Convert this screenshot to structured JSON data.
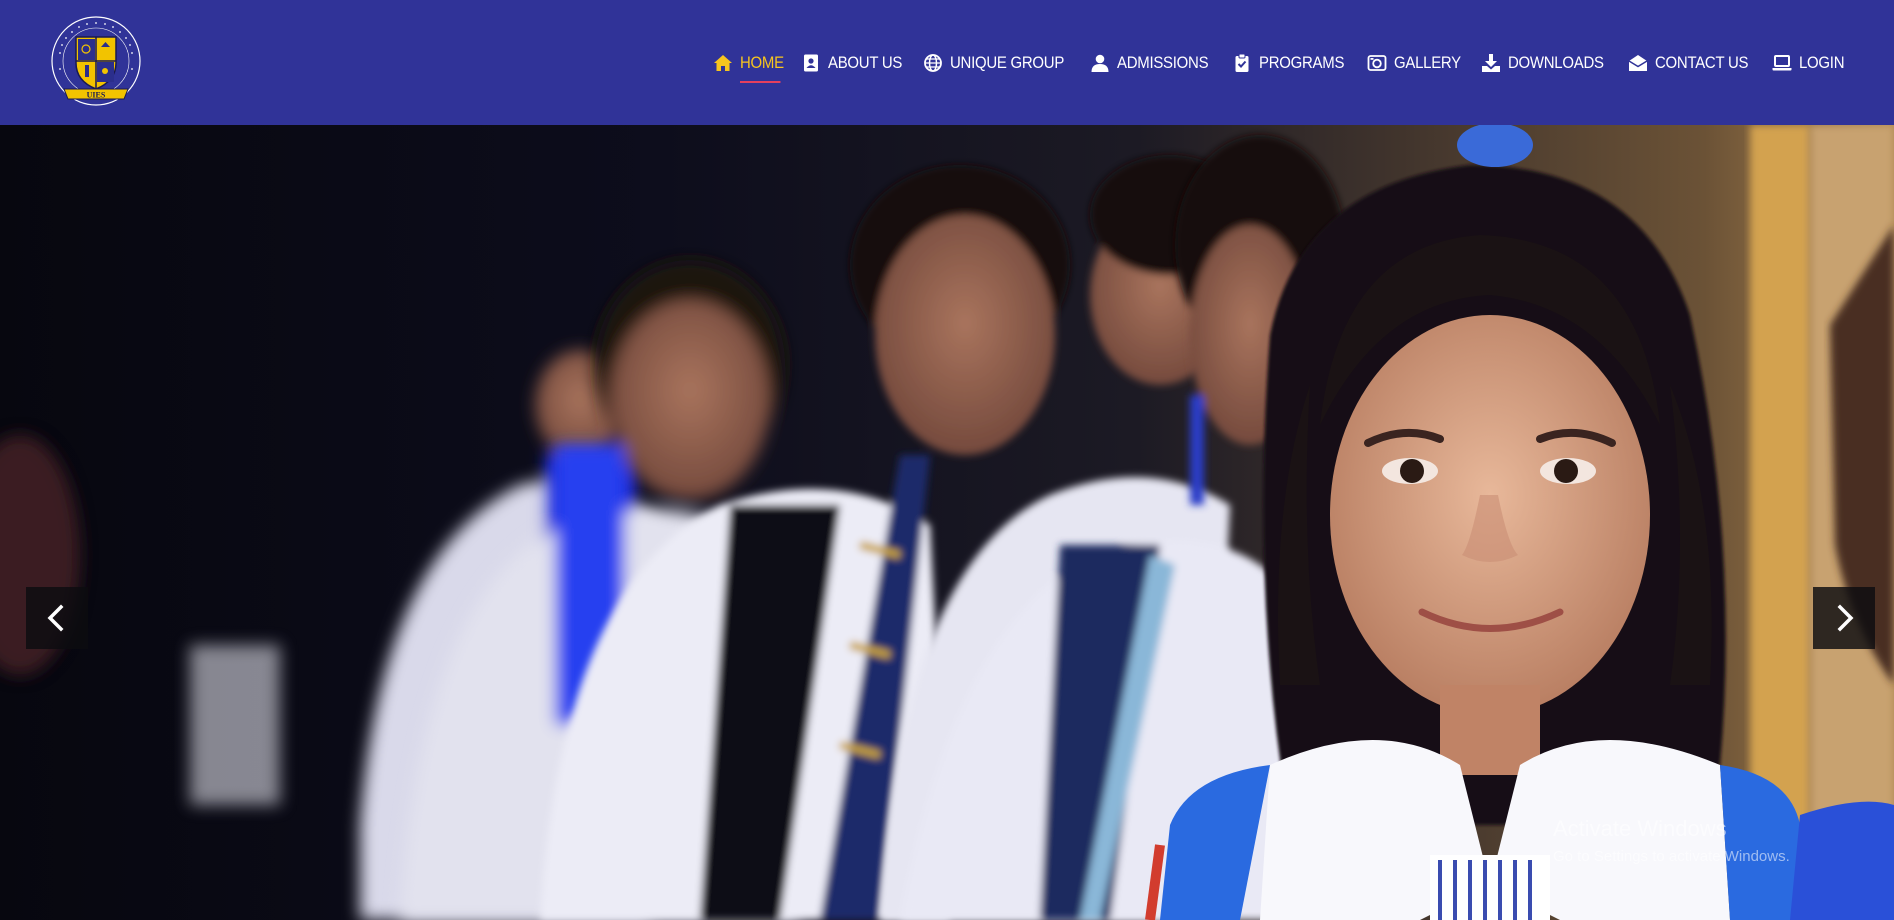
{
  "brand": {
    "logo_name": "UIES",
    "logo_ring_text": "UNIQUE INTERNATIONAL EDUCATIONAL SERVICES (PVT) LTD",
    "colors": {
      "header": "#303398",
      "active_nav": "#f7c51e",
      "underline": "#e5405e",
      "logo_gold": "#f2c300"
    }
  },
  "nav": {
    "items": [
      {
        "label": "HOME",
        "icon": "home-icon",
        "active": true
      },
      {
        "label": "ABOUT US",
        "icon": "contact-card-icon",
        "active": false
      },
      {
        "label": "UNIQUE GROUP",
        "icon": "globe-icon",
        "active": false
      },
      {
        "label": "ADMISSIONS",
        "icon": "user-icon",
        "active": false
      },
      {
        "label": "PROGRAMS",
        "icon": "clipboard-check-icon",
        "active": false
      },
      {
        "label": "GALLERY",
        "icon": "camera-icon",
        "active": false
      },
      {
        "label": "DOWNLOADS",
        "icon": "download-icon",
        "active": false
      },
      {
        "label": "CONTACT US",
        "icon": "envelope-open-icon",
        "active": false
      },
      {
        "label": "LOGIN",
        "icon": "laptop-icon",
        "active": false
      }
    ]
  },
  "hero": {
    "slide_description_icon": "photo",
    "prev_icon": "chevron-left-icon",
    "next_icon": "chevron-right-icon"
  },
  "watermark": {
    "title": "Activate Windows",
    "subtitle": "Go to Settings to activate Windows."
  }
}
